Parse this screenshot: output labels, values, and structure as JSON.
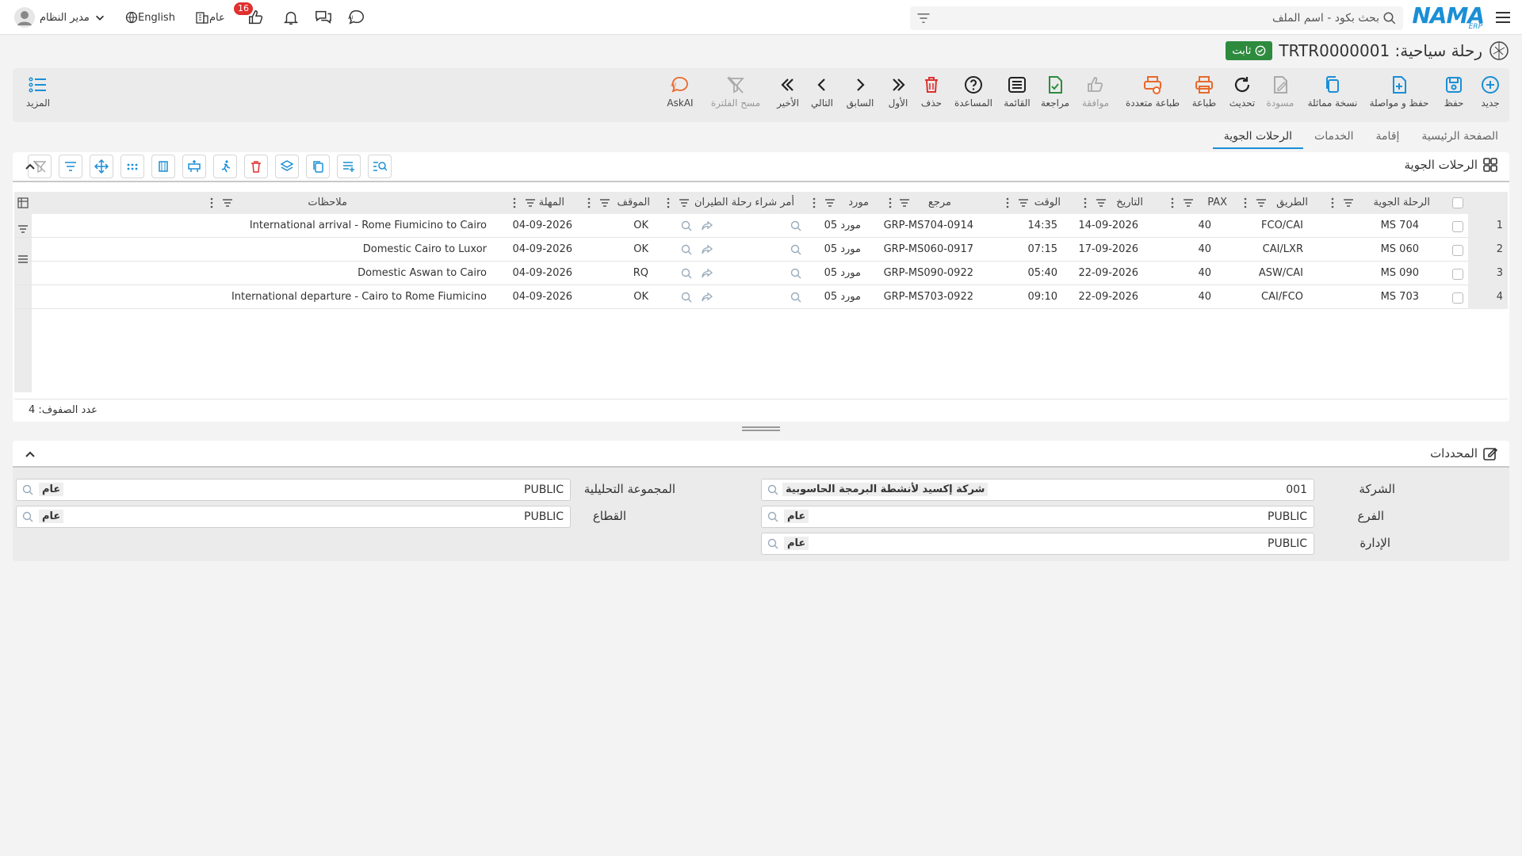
{
  "topbar": {
    "search_placeholder": "بحث بكود - اسم الملف",
    "brand": "NAMA",
    "brand_sub": "ERP",
    "user_name": "مدير النظام",
    "language": "English",
    "scope": "عام",
    "notifications_count": "16"
  },
  "header": {
    "title": "رحلة سياحية: TRTR0000001",
    "status": "ثابت"
  },
  "toolbar": {
    "new": "جديد",
    "save": "حفظ",
    "save_continue": "حفظ و مواصلة",
    "duplicate": "نسخة مماثلة",
    "draft": "مسودة",
    "refresh": "تحديث",
    "print": "طباعة",
    "multi_print": "طباعة متعددة",
    "approve": "موافقة",
    "review": "مراجعة",
    "list": "القائمة",
    "help": "المساعدة",
    "delete": "حذف",
    "first": "الأول",
    "previous": "السابق",
    "next": "التالي",
    "last": "الأخير",
    "clear_filter": "مسح الفلترة",
    "askai": "AskAI",
    "more": "المزيد"
  },
  "tabs": [
    {
      "label": "الصفحة الرئيسية"
    },
    {
      "label": "إقامة"
    },
    {
      "label": "الخدمات"
    },
    {
      "label": "الرحلات الجوية"
    }
  ],
  "grid": {
    "title": "الرحلات الجوية",
    "columns": {
      "flight": "الرحلة الجوية",
      "route": "الطريق",
      "pax": "PAX",
      "date": "التاريخ",
      "time": "الوقت",
      "ref": "مرجع",
      "supplier": "مورد",
      "po": "أمر شراء رحلة الطيران",
      "status": "الموقف",
      "deadline": "المهلة",
      "notes": "ملاحظات"
    },
    "rows": [
      {
        "n": "1",
        "flight": "MS 704",
        "route": "FCO/CAI",
        "pax": "40",
        "date": "14-09-2026",
        "time": "14:35",
        "ref": "GRP-MS704-0914",
        "supplier": "مورد 05",
        "status": "OK",
        "deadline": "04-09-2026",
        "notes": "International arrival - Rome Fiumicino to Cairo"
      },
      {
        "n": "2",
        "flight": "MS 060",
        "route": "CAI/LXR",
        "pax": "40",
        "date": "17-09-2026",
        "time": "07:15",
        "ref": "GRP-MS060-0917",
        "supplier": "مورد 05",
        "status": "OK",
        "deadline": "04-09-2026",
        "notes": "Domestic Cairo to Luxor"
      },
      {
        "n": "3",
        "flight": "MS 090",
        "route": "ASW/CAI",
        "pax": "40",
        "date": "22-09-2026",
        "time": "05:40",
        "ref": "GRP-MS090-0922",
        "supplier": "مورد 05",
        "status": "RQ",
        "deadline": "04-09-2026",
        "notes": "Domestic Aswan to Cairo"
      },
      {
        "n": "4",
        "flight": "MS 703",
        "route": "CAI/FCO",
        "pax": "40",
        "date": "22-09-2026",
        "time": "09:10",
        "ref": "GRP-MS703-0922",
        "supplier": "مورد 05",
        "status": "OK",
        "deadline": "04-09-2026",
        "notes": "International departure - Cairo to Rome Fiumicino"
      }
    ],
    "row_count": "عدد الصفوف: 4"
  },
  "qualifiers": {
    "title": "المحددات",
    "company_label": "الشركة",
    "company_code": "001",
    "company_name": "شركة إكسيد لأنشطة البرمجة الحاسوبية",
    "branch_label": "الفرع",
    "branch_code": "PUBLIC",
    "branch_name": "عام",
    "dept_label": "الإدارة",
    "dept_code": "PUBLIC",
    "dept_name": "عام",
    "analysis_label": "المجموعة التحليلية",
    "analysis_code": "PUBLIC",
    "analysis_name": "عام",
    "sector_label": "القطاع",
    "sector_code": "PUBLIC",
    "sector_name": "عام"
  },
  "colors": {
    "accent": "#1a8fd6",
    "status_green": "#2e8b3e",
    "danger": "#e03030",
    "print_orange": "#e8692b"
  }
}
